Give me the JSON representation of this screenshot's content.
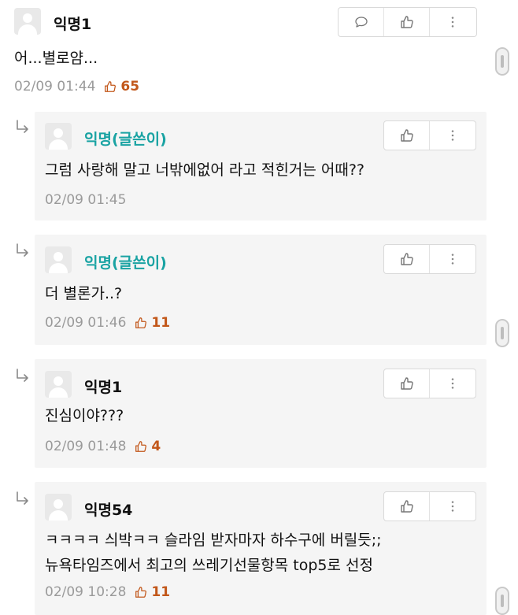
{
  "comments": [
    {
      "author": "익명1",
      "text": "어...별로얌...",
      "time": "02/09 01:44",
      "likes": "65"
    },
    {
      "author": "익명(글쓴이)",
      "text": "그럼 사랑해 말고 너밖에없어 라고 적힌거는 어때??",
      "time": "02/09 01:45",
      "likes": ""
    },
    {
      "author": "익명(글쓴이)",
      "text": "더 별론가..?",
      "time": "02/09 01:46",
      "likes": "11"
    },
    {
      "author": "익명1",
      "text": "진심이야???",
      "time": "02/09 01:48",
      "likes": "4"
    },
    {
      "author": "익명54",
      "text_lines": [
        "ㅋㅋㅋㅋ 싀박ㅋㅋ 슬라임 받자마자 하수구에 버릴듯;;",
        "뉴욕타임즈에서 최고의 쓰레기선물항목 top5로 선정"
      ],
      "time": "02/09 10:28",
      "likes": "11"
    }
  ],
  "icons": {
    "comment": "comment-bubble-icon",
    "like": "thumbs-up-icon",
    "more": "more-vertical-icon",
    "reply": "reply-arrow-icon",
    "avatar": "user-avatar-icon"
  },
  "colors": {
    "op_author": "#1aa3a3",
    "likes": "#c2571a",
    "meta": "#9a9a9a",
    "reply_bg": "#f5f5f5"
  }
}
